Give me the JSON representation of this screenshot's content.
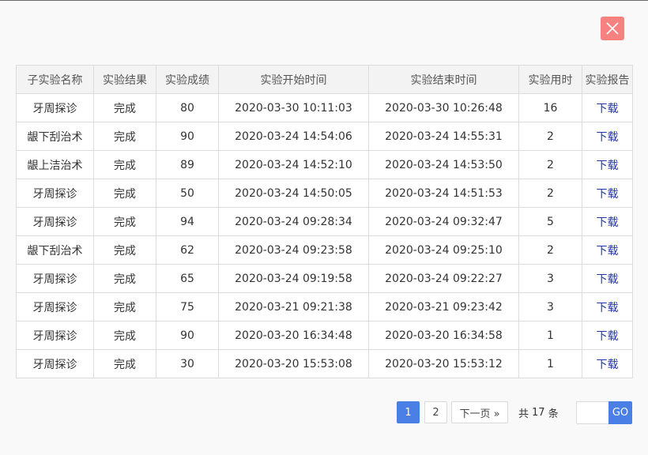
{
  "table": {
    "headers": [
      "子实验名称",
      "实验结果",
      "实验成绩",
      "实验开始时间",
      "实验结束时间",
      "实验用时",
      "实验报告"
    ],
    "rows": [
      {
        "name": "牙周探诊",
        "result": "完成",
        "score": "80",
        "start": "2020-03-30 10:11:03",
        "end": "2020-03-30 10:26:48",
        "duration": "16",
        "report": "下载"
      },
      {
        "name": "龈下刮治术",
        "result": "完成",
        "score": "90",
        "start": "2020-03-24 14:54:06",
        "end": "2020-03-24 14:55:31",
        "duration": "2",
        "report": "下载"
      },
      {
        "name": "龈上洁治术",
        "result": "完成",
        "score": "89",
        "start": "2020-03-24 14:52:10",
        "end": "2020-03-24 14:53:50",
        "duration": "2",
        "report": "下载"
      },
      {
        "name": "牙周探诊",
        "result": "完成",
        "score": "50",
        "start": "2020-03-24 14:50:05",
        "end": "2020-03-24 14:51:53",
        "duration": "2",
        "report": "下载"
      },
      {
        "name": "牙周探诊",
        "result": "完成",
        "score": "94",
        "start": "2020-03-24 09:28:34",
        "end": "2020-03-24 09:32:47",
        "duration": "5",
        "report": "下载"
      },
      {
        "name": "龈下刮治术",
        "result": "完成",
        "score": "62",
        "start": "2020-03-24 09:23:58",
        "end": "2020-03-24 09:25:10",
        "duration": "2",
        "report": "下载"
      },
      {
        "name": "牙周探诊",
        "result": "完成",
        "score": "65",
        "start": "2020-03-24 09:19:58",
        "end": "2020-03-24 09:22:27",
        "duration": "3",
        "report": "下载"
      },
      {
        "name": "牙周探诊",
        "result": "完成",
        "score": "75",
        "start": "2020-03-21 09:21:38",
        "end": "2020-03-21 09:23:42",
        "duration": "3",
        "report": "下载"
      },
      {
        "name": "牙周探诊",
        "result": "完成",
        "score": "90",
        "start": "2020-03-20 16:34:48",
        "end": "2020-03-20 16:34:58",
        "duration": "1",
        "report": "下载"
      },
      {
        "name": "牙周探诊",
        "result": "完成",
        "score": "30",
        "start": "2020-03-20 15:53:08",
        "end": "2020-03-20 15:53:12",
        "duration": "1",
        "report": "下载"
      }
    ]
  },
  "pagination": {
    "pages": [
      "1",
      "2"
    ],
    "current": "1",
    "next_label": "下一页 »",
    "total_prefix": "共",
    "total_count": "17",
    "total_suffix": "条",
    "jump_value": "",
    "go_label": "GO"
  },
  "icons": {
    "close": "close-icon"
  },
  "colors": {
    "close_bg": "#f78181",
    "accent": "#4a80e6",
    "link": "#2233aa"
  }
}
